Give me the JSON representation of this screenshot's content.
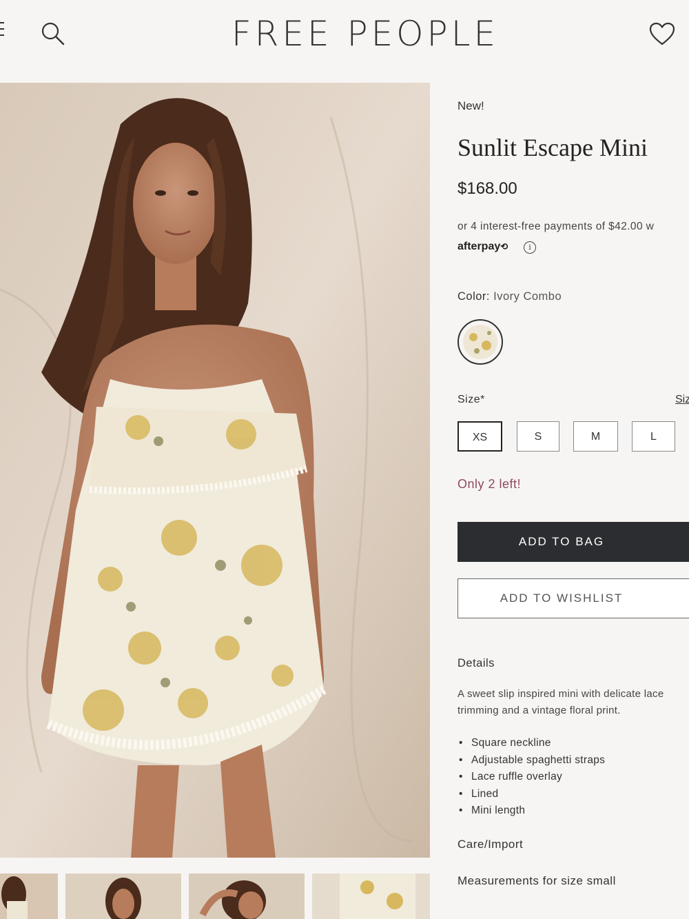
{
  "header": {
    "brand": "FREE PEOPLE",
    "menu_icon": "menu-icon",
    "search_icon": "search-icon",
    "wishlist_icon": "heart-icon"
  },
  "gallery": {
    "main_image": "model-wearing-floral-slip-dress",
    "thumbnails": [
      "thumbnail-1",
      "thumbnail-2",
      "thumbnail-3",
      "thumbnail-4"
    ]
  },
  "product": {
    "badge": "New!",
    "name": "Sunlit Escape Mini",
    "price": "$168.00",
    "afterpay_text": "or 4 interest-free payments of $42.00 w",
    "afterpay_logo": "afterpay",
    "info_glyph": "i",
    "color_label": "Color:",
    "color_value": "Ivory Combo",
    "size_label": "Size*",
    "size_guide": "Siz",
    "sizes": [
      "XS",
      "S",
      "M",
      "L"
    ],
    "selected_size": "XS",
    "stock_message": "Only 2 left!",
    "add_to_bag": "ADD TO BAG",
    "add_to_wishlist": "ADD TO WISHLIST",
    "details_heading": "Details",
    "description": "A sweet slip inspired mini with delicate lace trimming and a vintage floral print.",
    "features": [
      "Square neckline",
      "Adjustable spaghetti straps",
      "Lace ruffle overlay",
      "Lined",
      "Mini length"
    ],
    "care_heading": "Care/Import",
    "measurements_heading": "Measurements for size small"
  },
  "colors": {
    "background": "#f7f5f3",
    "button_dark": "#2b2d30",
    "stock_text": "#8c4a5d"
  }
}
